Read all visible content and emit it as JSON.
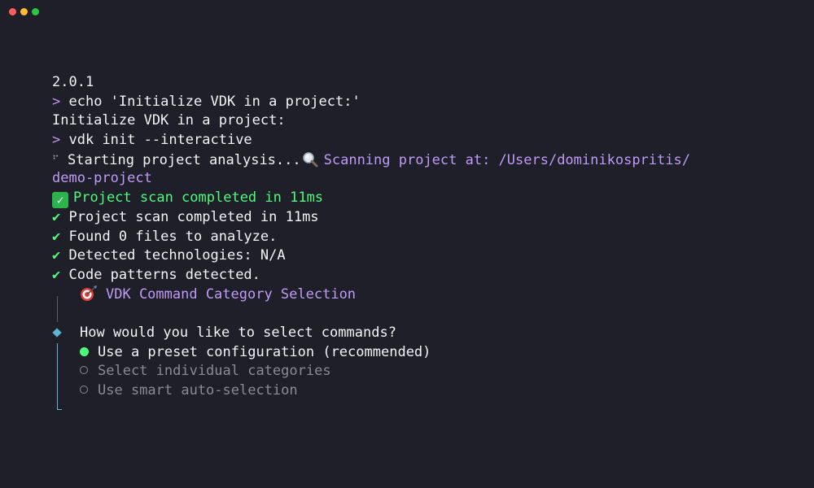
{
  "window": {
    "controls": [
      "close",
      "minimize",
      "zoom"
    ]
  },
  "terminal": {
    "version": "2.0.1",
    "prompt_symbol": ">",
    "cmd1": "echo 'Initialize VDK in a project:'",
    "out1": "Initialize VDK in a project:",
    "cmd2": "vdk init --interactive",
    "spinner": "⠋",
    "analysis": "Starting project analysis...",
    "scanning": "Scanning project at: /Users/dominikospritis/",
    "scanning_cont": "demo-project",
    "scan_done_emoji": "Project scan completed in 11ms",
    "checks": [
      "Project scan completed in 11ms",
      "Found 0 files to analyze.",
      "Detected technologies: N/A",
      "Code patterns detected."
    ],
    "check_symbol": "✔",
    "section_title": "VDK Command Category Selection",
    "question": "How would you like to select commands?",
    "options": [
      {
        "label": "Use a preset configuration (recommended)",
        "selected": true
      },
      {
        "label": "Select individual categories",
        "selected": false
      },
      {
        "label": "Use smart auto-selection",
        "selected": false
      }
    ]
  },
  "colors": {
    "background": "#1e1f29",
    "accent_purple": "#c19af7",
    "accent_green": "#50fa7b",
    "accent_cyan": "#5fb3d3"
  }
}
